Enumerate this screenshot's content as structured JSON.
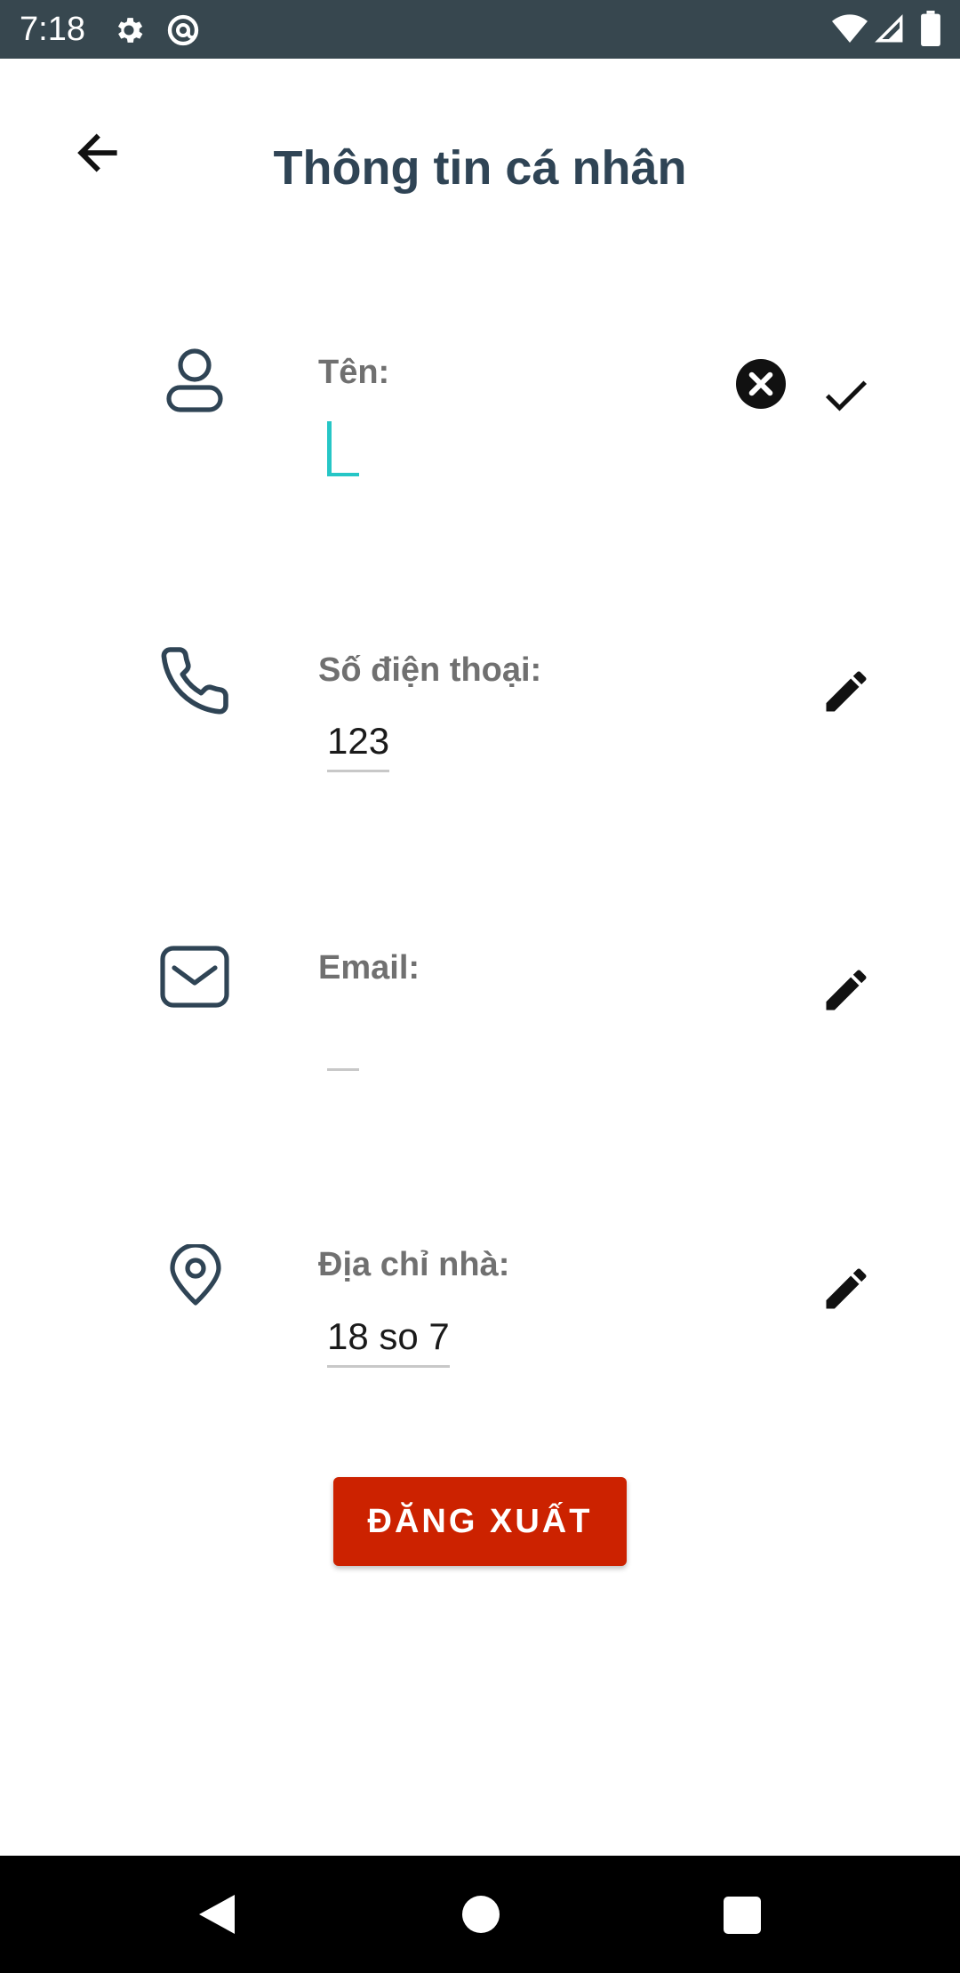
{
  "status_bar": {
    "time": "7:18",
    "icons": [
      "gear-icon",
      "at-circle-icon",
      "wifi-icon",
      "signal-icon",
      "battery-icon"
    ]
  },
  "header": {
    "title": "Thông tin cá nhân",
    "back_icon": "arrow-left-icon"
  },
  "fields": [
    {
      "label": "Tên:",
      "value": "",
      "icon": "person-icon",
      "state": "editing"
    },
    {
      "label": "Số điện thoại:",
      "value": "123",
      "icon": "phone-icon",
      "state": "view"
    },
    {
      "label": "Email:",
      "value": "",
      "icon": "mail-icon",
      "state": "view"
    },
    {
      "label": "Địa chỉ nhà:",
      "value": "18 so 7",
      "icon": "location-pin-icon",
      "state": "view"
    }
  ],
  "logout": {
    "label": "ĐĂNG XUẤT"
  },
  "colors": {
    "status_bar": "#37474f",
    "title": "#2f4455",
    "label": "#707070",
    "cursor_accent": "#26c6c6",
    "logout_button": "#cc2200"
  }
}
